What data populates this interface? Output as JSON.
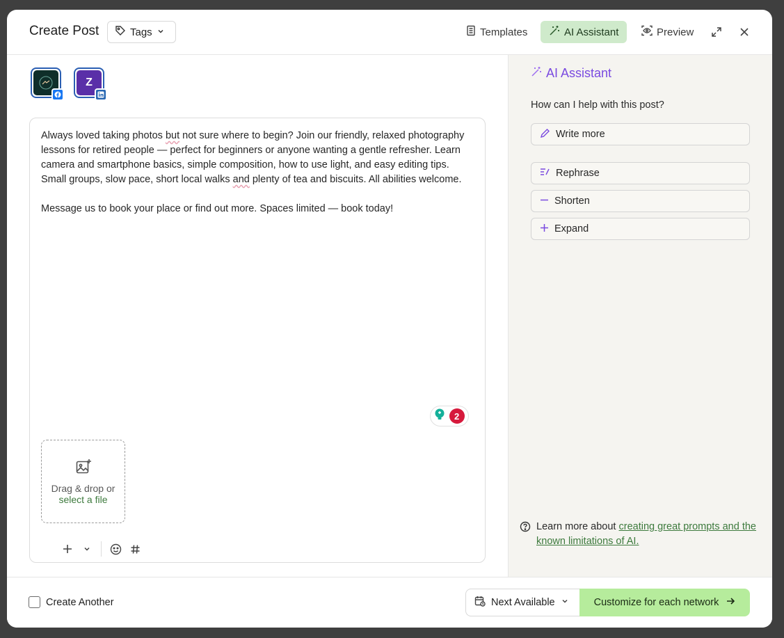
{
  "modal": {
    "title": "Create Post",
    "tags_label": "Tags",
    "templates_label": "Templates",
    "ai_assistant_label": "AI Assistant",
    "preview_label": "Preview"
  },
  "accounts": [
    {
      "network": "facebook",
      "initial": ""
    },
    {
      "network": "linkedin",
      "initial": "Z"
    }
  ],
  "editor": {
    "para1_a": "Always loved taking photos ",
    "para1_w1": "but",
    "para1_b": " not sure where to begin? Join our friendly, relaxed photography lessons for retired people — perfect for beginners or anyone wanting a gentle refresher. Learn camera and smartphone basics, simple composition, how to use light, and easy editing tips. Small groups, slow pace, short local walks ",
    "para1_w2": "and",
    "para1_c": " plenty of tea and biscuits. All abilities welcome.",
    "para2": "Message us to book your place or find out more. Spaces limited — book today!",
    "grammar_count": "2",
    "drop_text": "Drag & drop or",
    "drop_link": "select a file"
  },
  "ai": {
    "title": "AI Assistant",
    "question": "How can I help with this post?",
    "write_more": "Write more",
    "rephrase": "Rephrase",
    "shorten": "Shorten",
    "expand": "Expand",
    "help_prefix": "Learn more about ",
    "help_link": "creating great prompts and the known limitations of AI."
  },
  "footer": {
    "create_another": "Create Another",
    "schedule": "Next Available",
    "customize": "Customize for each network"
  },
  "colors": {
    "accent_green": "#b6ec9c",
    "ai_purple": "#7a4ae0",
    "link_green": "#3d7a3d",
    "facebook_blue": "#1877f2",
    "linkedin_blue": "#2867b2"
  }
}
